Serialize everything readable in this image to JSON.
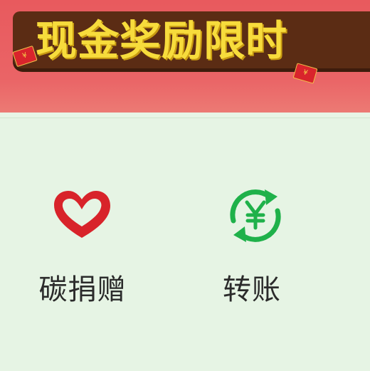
{
  "banner": {
    "headline": "现金奖励限时",
    "envelope_glyph_1": "¥",
    "envelope_glyph_2": "¥",
    "colors": {
      "background": "#e85a5e",
      "headline": "#f7dc3c",
      "plate": "#5b2c14"
    }
  },
  "services": [
    {
      "label": "碳捐赠",
      "icon": "heart-icon",
      "color": "#d8232a"
    },
    {
      "label": "转账",
      "icon": "yuan-transfer-icon",
      "color": "#1fb14a"
    }
  ]
}
